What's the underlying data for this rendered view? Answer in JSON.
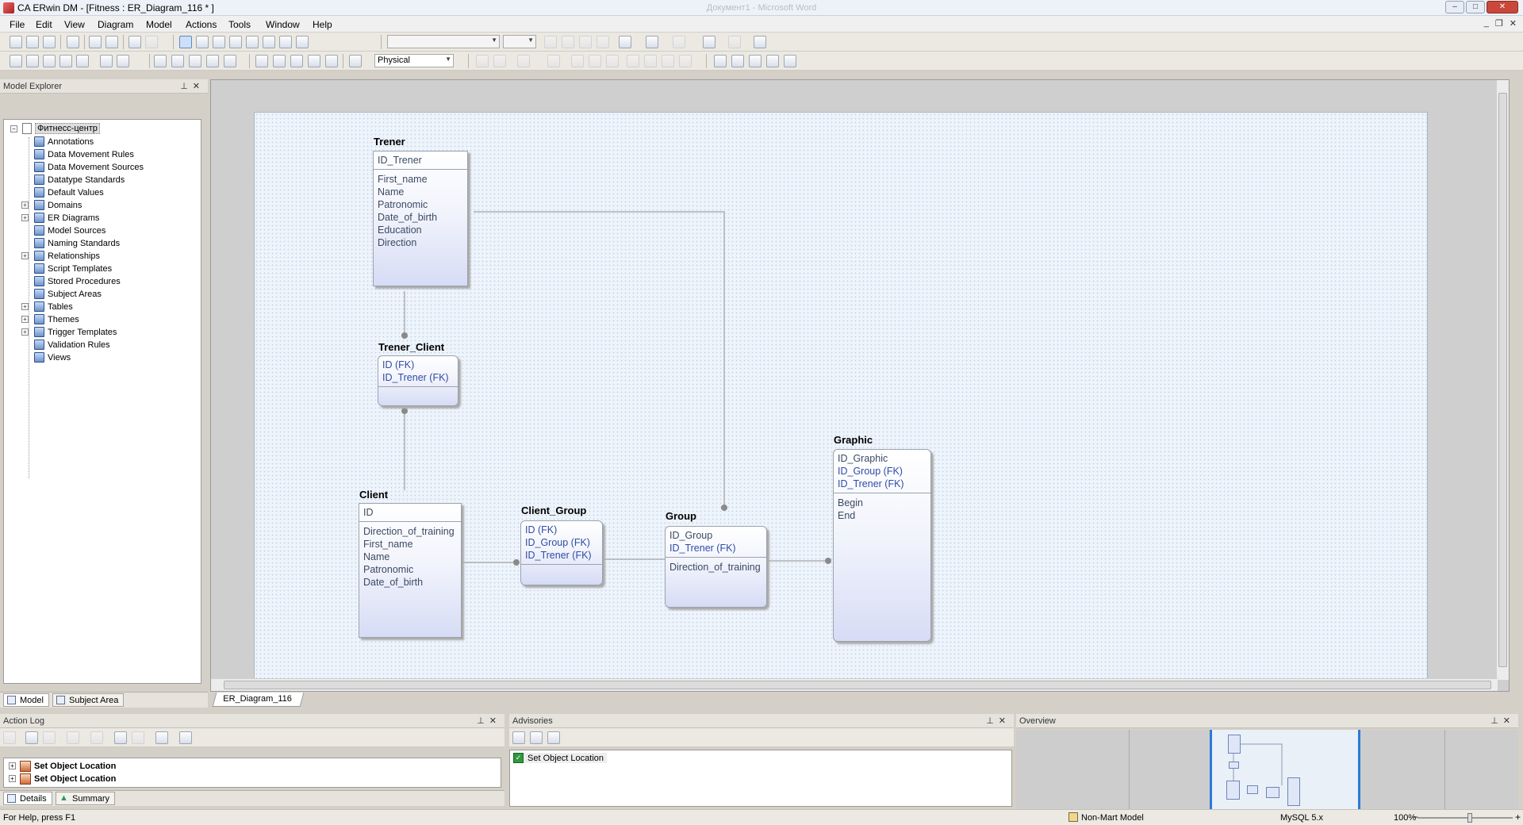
{
  "window": {
    "title": "CA ERwin DM - [Fitness : ER_Diagram_116 * ]",
    "ghost_title": "Документ1 - Microsoft Word"
  },
  "menu": [
    "File",
    "Edit",
    "View",
    "Diagram",
    "Model",
    "Actions",
    "Tools",
    "Window",
    "Help"
  ],
  "toolbar": {
    "notation_combo": "Physical"
  },
  "model_explorer": {
    "title": "Model Explorer",
    "root": "Фитнесс-центр",
    "items": [
      {
        "label": "Annotations",
        "expandable": false
      },
      {
        "label": "Data Movement Rules",
        "expandable": false
      },
      {
        "label": "Data Movement Sources",
        "expandable": false
      },
      {
        "label": "Datatype Standards",
        "expandable": false
      },
      {
        "label": "Default Values",
        "expandable": false
      },
      {
        "label": "Domains",
        "expandable": true
      },
      {
        "label": "ER Diagrams",
        "expandable": true
      },
      {
        "label": "Model Sources",
        "expandable": false
      },
      {
        "label": "Naming Standards",
        "expandable": false
      },
      {
        "label": "Relationships",
        "expandable": true
      },
      {
        "label": "Script Templates",
        "expandable": false
      },
      {
        "label": "Stored Procedures",
        "expandable": false
      },
      {
        "label": "Subject Areas",
        "expandable": false
      },
      {
        "label": "Tables",
        "expandable": true
      },
      {
        "label": "Themes",
        "expandable": true
      },
      {
        "label": "Trigger Templates",
        "expandable": true
      },
      {
        "label": "Validation Rules",
        "expandable": false
      },
      {
        "label": "Views",
        "expandable": false
      }
    ],
    "tabs": [
      "Model",
      "Subject Area"
    ]
  },
  "diagram": {
    "tab": "ER_Diagram_116",
    "entities": {
      "trener": {
        "name": "Trener",
        "keys": [
          "ID_Trener"
        ],
        "attrs": [
          "First_name",
          "Name",
          "Patronomic",
          "Date_of_birth",
          "Education",
          "Direction"
        ]
      },
      "trener_client": {
        "name": "Trener_Client",
        "keys": [
          "ID (FK)",
          "ID_Trener (FK)"
        ],
        "attrs": []
      },
      "client": {
        "name": "Client",
        "keys": [
          "ID"
        ],
        "attrs": [
          "Direction_of_training",
          "First_name",
          "Name",
          "Patronomic",
          "Date_of_birth"
        ]
      },
      "client_group": {
        "name": "Client_Group",
        "keys": [
          "ID (FK)",
          "ID_Group (FK)",
          "ID_Trener (FK)"
        ],
        "attrs": []
      },
      "group": {
        "name": "Group",
        "keys": [
          "ID_Group",
          "ID_Trener (FK)"
        ],
        "attrs": [
          "Direction_of_training"
        ]
      },
      "graphic": {
        "name": "Graphic",
        "keys": [
          "ID_Graphic",
          "ID_Group (FK)",
          "ID_Trener (FK)"
        ],
        "attrs": [
          "Begin",
          "End"
        ]
      }
    }
  },
  "action_log": {
    "title": "Action Log",
    "rows": [
      "Set Object Location",
      "Set Object Location"
    ],
    "tabs": [
      "Details",
      "Summary"
    ]
  },
  "advisories": {
    "title": "Advisories",
    "rows": [
      "Set Object Location"
    ]
  },
  "overview": {
    "title": "Overview"
  },
  "status": {
    "help": "For Help, press F1",
    "model_type": "Non-Mart Model",
    "database": "MySQL 5.x",
    "zoom": "100%",
    "zoom_level": 0.55
  }
}
